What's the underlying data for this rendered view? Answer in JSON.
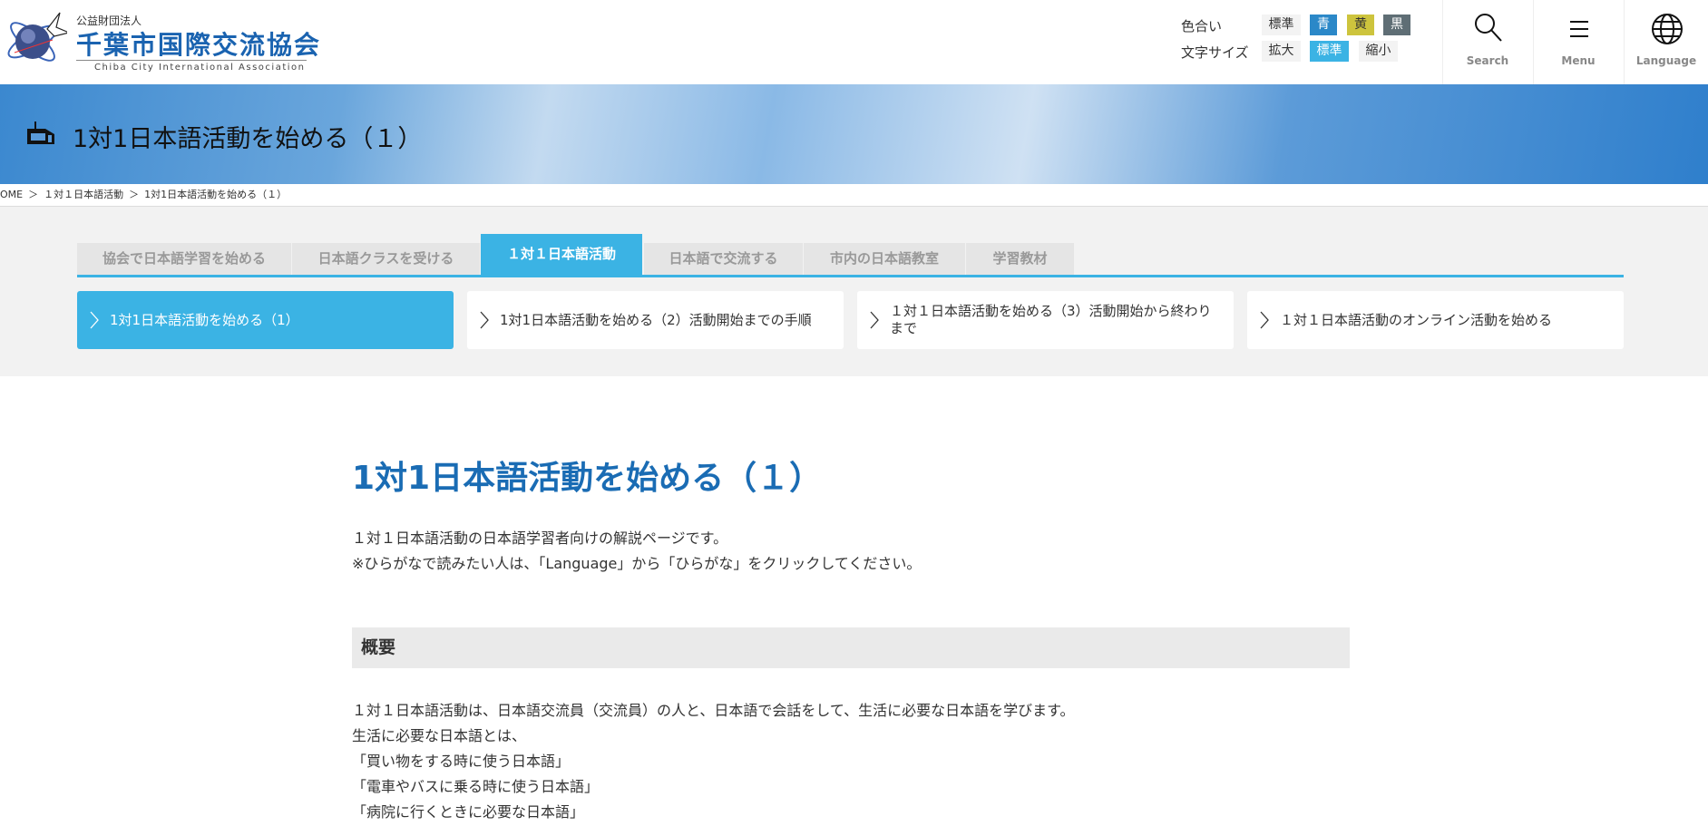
{
  "header": {
    "logo": {
      "org_type": "公益財団法人",
      "name": "千葉市国際交流協会",
      "english": "Chiba City International Association"
    },
    "color_label": "色合い",
    "color_options": [
      {
        "label": "標準",
        "bg": "#f3f3f3",
        "fg": "#333333"
      },
      {
        "label": "青",
        "bg": "#2b88c8",
        "fg": "#ffffff"
      },
      {
        "label": "黄",
        "bg": "#cdc43d",
        "fg": "#333333"
      },
      {
        "label": "黒",
        "bg": "#5f6e75",
        "fg": "#ffffff"
      }
    ],
    "size_label": "文字サイズ",
    "size_options": [
      {
        "label": "拡大",
        "selected": false
      },
      {
        "label": "標準",
        "selected": true
      },
      {
        "label": "縮小",
        "selected": false
      }
    ],
    "buttons": [
      {
        "label": "Search",
        "icon": "search-icon"
      },
      {
        "label": "Menu",
        "icon": "menu-icon"
      },
      {
        "label": "Language",
        "icon": "globe-icon"
      }
    ]
  },
  "hero": {
    "title": "1対1日本語活動を始める（１）",
    "icon": "home-icon"
  },
  "breadcrumb": [
    "OME",
    "＞",
    "１対１日本語活動",
    "＞",
    "1対1日本語活動を始める（１）"
  ],
  "tabs": [
    {
      "label": "協会で日本語学習を始める",
      "active": false
    },
    {
      "label": "日本語クラスを受ける",
      "active": false
    },
    {
      "label": "１対１日本語活動",
      "active": true
    },
    {
      "label": "日本語で交流する",
      "active": false
    },
    {
      "label": "市内の日本語教室",
      "active": false
    },
    {
      "label": "学習教材",
      "active": false
    }
  ],
  "subnav": [
    {
      "label": "1対1日本語活動を始める（1）",
      "active": true
    },
    {
      "label": "1対1日本語活動を始める（2）活動開始までの手順",
      "active": false
    },
    {
      "label": "１対１日本語活動を始める（3）活動開始から終わりまで",
      "active": false
    },
    {
      "label": "１対１日本語活動のオンライン活動を始める",
      "active": false
    }
  ],
  "content": {
    "title": "1対1日本語活動を始める（１）",
    "intro": [
      "１対１日本語活動の日本語学習者向けの解説ページです。",
      "※ひらがなで読みたい人は、「Language」から「ひらがな」をクリックしてください。"
    ],
    "section_heading": "概要",
    "section_lines": [
      "１対１日本語活動は、日本語交流員（交流員）の人と、日本語で会話をして、生活に必要な日本語を学びます。",
      "生活に必要な日本語とは、",
      "「買い物をする時に使う日本語」",
      "「電車やバスに乗る時に使う日本語」",
      "「病院に行くときに必要な日本語」"
    ]
  },
  "accent": "#3bb3e4"
}
